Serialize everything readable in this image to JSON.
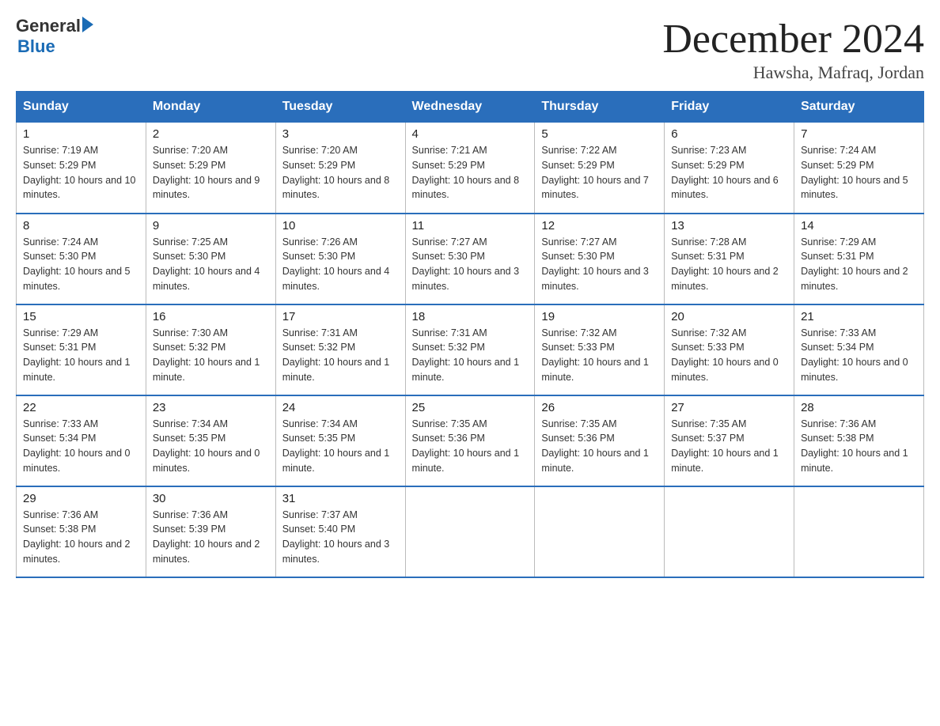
{
  "logo": {
    "text_general": "General",
    "text_blue": "Blue",
    "arrow": "▶"
  },
  "title": "December 2024",
  "location": "Hawsha, Mafraq, Jordan",
  "days_of_week": [
    "Sunday",
    "Monday",
    "Tuesday",
    "Wednesday",
    "Thursday",
    "Friday",
    "Saturday"
  ],
  "weeks": [
    [
      {
        "day": "1",
        "sunrise": "7:19 AM",
        "sunset": "5:29 PM",
        "daylight": "10 hours and 10 minutes."
      },
      {
        "day": "2",
        "sunrise": "7:20 AM",
        "sunset": "5:29 PM",
        "daylight": "10 hours and 9 minutes."
      },
      {
        "day": "3",
        "sunrise": "7:20 AM",
        "sunset": "5:29 PM",
        "daylight": "10 hours and 8 minutes."
      },
      {
        "day": "4",
        "sunrise": "7:21 AM",
        "sunset": "5:29 PM",
        "daylight": "10 hours and 8 minutes."
      },
      {
        "day": "5",
        "sunrise": "7:22 AM",
        "sunset": "5:29 PM",
        "daylight": "10 hours and 7 minutes."
      },
      {
        "day": "6",
        "sunrise": "7:23 AM",
        "sunset": "5:29 PM",
        "daylight": "10 hours and 6 minutes."
      },
      {
        "day": "7",
        "sunrise": "7:24 AM",
        "sunset": "5:29 PM",
        "daylight": "10 hours and 5 minutes."
      }
    ],
    [
      {
        "day": "8",
        "sunrise": "7:24 AM",
        "sunset": "5:30 PM",
        "daylight": "10 hours and 5 minutes."
      },
      {
        "day": "9",
        "sunrise": "7:25 AM",
        "sunset": "5:30 PM",
        "daylight": "10 hours and 4 minutes."
      },
      {
        "day": "10",
        "sunrise": "7:26 AM",
        "sunset": "5:30 PM",
        "daylight": "10 hours and 4 minutes."
      },
      {
        "day": "11",
        "sunrise": "7:27 AM",
        "sunset": "5:30 PM",
        "daylight": "10 hours and 3 minutes."
      },
      {
        "day": "12",
        "sunrise": "7:27 AM",
        "sunset": "5:30 PM",
        "daylight": "10 hours and 3 minutes."
      },
      {
        "day": "13",
        "sunrise": "7:28 AM",
        "sunset": "5:31 PM",
        "daylight": "10 hours and 2 minutes."
      },
      {
        "day": "14",
        "sunrise": "7:29 AM",
        "sunset": "5:31 PM",
        "daylight": "10 hours and 2 minutes."
      }
    ],
    [
      {
        "day": "15",
        "sunrise": "7:29 AM",
        "sunset": "5:31 PM",
        "daylight": "10 hours and 1 minute."
      },
      {
        "day": "16",
        "sunrise": "7:30 AM",
        "sunset": "5:32 PM",
        "daylight": "10 hours and 1 minute."
      },
      {
        "day": "17",
        "sunrise": "7:31 AM",
        "sunset": "5:32 PM",
        "daylight": "10 hours and 1 minute."
      },
      {
        "day": "18",
        "sunrise": "7:31 AM",
        "sunset": "5:32 PM",
        "daylight": "10 hours and 1 minute."
      },
      {
        "day": "19",
        "sunrise": "7:32 AM",
        "sunset": "5:33 PM",
        "daylight": "10 hours and 1 minute."
      },
      {
        "day": "20",
        "sunrise": "7:32 AM",
        "sunset": "5:33 PM",
        "daylight": "10 hours and 0 minutes."
      },
      {
        "day": "21",
        "sunrise": "7:33 AM",
        "sunset": "5:34 PM",
        "daylight": "10 hours and 0 minutes."
      }
    ],
    [
      {
        "day": "22",
        "sunrise": "7:33 AM",
        "sunset": "5:34 PM",
        "daylight": "10 hours and 0 minutes."
      },
      {
        "day": "23",
        "sunrise": "7:34 AM",
        "sunset": "5:35 PM",
        "daylight": "10 hours and 0 minutes."
      },
      {
        "day": "24",
        "sunrise": "7:34 AM",
        "sunset": "5:35 PM",
        "daylight": "10 hours and 1 minute."
      },
      {
        "day": "25",
        "sunrise": "7:35 AM",
        "sunset": "5:36 PM",
        "daylight": "10 hours and 1 minute."
      },
      {
        "day": "26",
        "sunrise": "7:35 AM",
        "sunset": "5:36 PM",
        "daylight": "10 hours and 1 minute."
      },
      {
        "day": "27",
        "sunrise": "7:35 AM",
        "sunset": "5:37 PM",
        "daylight": "10 hours and 1 minute."
      },
      {
        "day": "28",
        "sunrise": "7:36 AM",
        "sunset": "5:38 PM",
        "daylight": "10 hours and 1 minute."
      }
    ],
    [
      {
        "day": "29",
        "sunrise": "7:36 AM",
        "sunset": "5:38 PM",
        "daylight": "10 hours and 2 minutes."
      },
      {
        "day": "30",
        "sunrise": "7:36 AM",
        "sunset": "5:39 PM",
        "daylight": "10 hours and 2 minutes."
      },
      {
        "day": "31",
        "sunrise": "7:37 AM",
        "sunset": "5:40 PM",
        "daylight": "10 hours and 3 minutes."
      },
      null,
      null,
      null,
      null
    ]
  ],
  "labels": {
    "sunrise": "Sunrise:",
    "sunset": "Sunset:",
    "daylight": "Daylight:"
  }
}
